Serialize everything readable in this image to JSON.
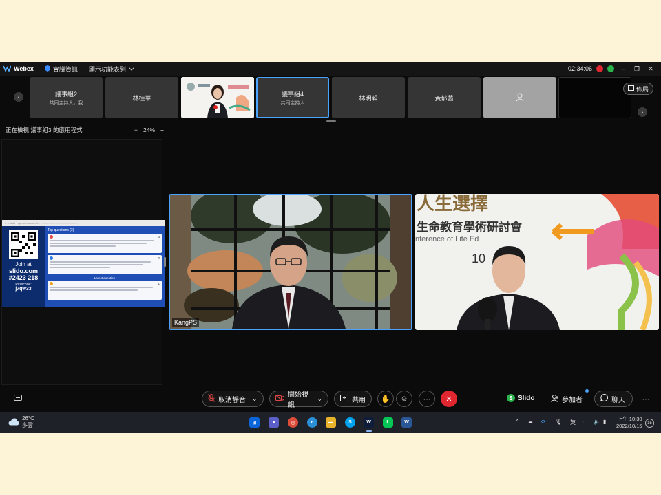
{
  "titlebar": {
    "app_name": "Webex",
    "meeting_info": "會議資訊",
    "show_menu": "顯示功能表列",
    "timer": "02:34:06"
  },
  "thumbnails": [
    {
      "name": "議事組2",
      "sub": "共同主持人，我"
    },
    {
      "name": "林桂華",
      "sub": ""
    },
    {
      "name": "",
      "sub": ""
    },
    {
      "name": "議事組4",
      "sub": "共同主持人"
    },
    {
      "name": "林明毅",
      "sub": ""
    },
    {
      "name": "黃郁茜",
      "sub": ""
    },
    {
      "name": "",
      "sub": ""
    },
    {
      "name": "",
      "sub": ""
    }
  ],
  "layout_button": "佈局",
  "viewing": {
    "label": "正在檢視 議事組3 的應用程式",
    "zoom": "24%"
  },
  "slido": {
    "join_at": "Join at",
    "site": "slido.com",
    "code": "#2423 218",
    "passcode_label": "Passcode:",
    "passcode": "j7qw33",
    "top_questions": "Top questions (3)",
    "latest_question": "Latest question",
    "q_votes": [
      "3",
      "2",
      "1"
    ]
  },
  "videos": {
    "left_name": "KangPS",
    "banner_line1": "人生選擇",
    "banner_line2": "生命教育學術研討會",
    "banner_line3": "nference of Life Ed",
    "banner_line4": "10"
  },
  "controls": {
    "mute": "取消靜音",
    "video": "開始視訊",
    "share": "共用",
    "slido": "Slido",
    "participants": "參加者",
    "chat": "聊天"
  },
  "taskbar": {
    "temp": "26°C",
    "weather": "多雲",
    "ime": "英",
    "time": "上午 10:30",
    "date": "2022/10/15",
    "notif": "15"
  },
  "colors": {
    "accent": "#4aa3ff",
    "end_call": "#e0262f",
    "slido_green": "#2bb34b",
    "slido_blue": "#1f4fb5"
  }
}
